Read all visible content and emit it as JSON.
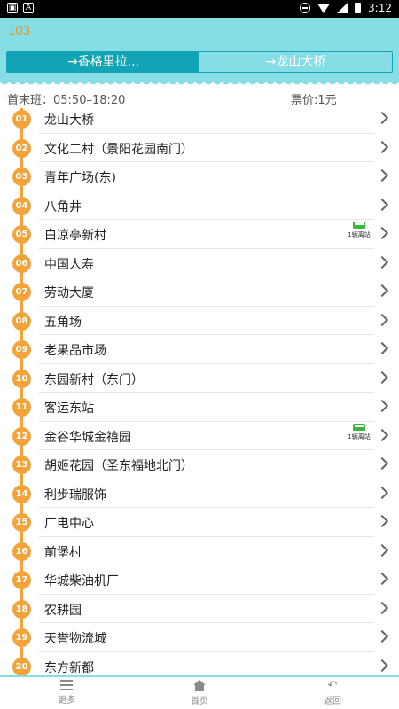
{
  "status_bar": {
    "time": "3:12",
    "left_icons": [
      "notification-icon",
      "a-icon"
    ]
  },
  "app_bar": {
    "title": "103"
  },
  "tabs": [
    {
      "label": "→香格里拉...",
      "active": true
    },
    {
      "label": "→龙山大桥",
      "active": false
    }
  ],
  "info": {
    "hours": "首末班：05:50–18:20",
    "fare": "票价:1元"
  },
  "stops": [
    {
      "num": "01",
      "name": "龙山大桥"
    },
    {
      "num": "02",
      "name": "文化二村（景阳花园南门）"
    },
    {
      "num": "03",
      "name": "青年广场(东)"
    },
    {
      "num": "04",
      "name": "八角井"
    },
    {
      "num": "05",
      "name": "白凉亭新村",
      "bus": "1辆离站"
    },
    {
      "num": "06",
      "name": "中国人寿"
    },
    {
      "num": "07",
      "name": "劳动大厦"
    },
    {
      "num": "08",
      "name": "五角场"
    },
    {
      "num": "09",
      "name": "老果品市场"
    },
    {
      "num": "10",
      "name": "东园新村（东门）"
    },
    {
      "num": "11",
      "name": "客运东站"
    },
    {
      "num": "12",
      "name": "金谷华城金禧园",
      "bus": "1辆离站"
    },
    {
      "num": "13",
      "name": "胡姬花园（圣东福地北门）"
    },
    {
      "num": "14",
      "name": "利步瑞服饰"
    },
    {
      "num": "15",
      "name": "广电中心"
    },
    {
      "num": "16",
      "name": "前堡村"
    },
    {
      "num": "17",
      "name": "华城柴油机厂"
    },
    {
      "num": "18",
      "name": "农耕园"
    },
    {
      "num": "19",
      "name": "天誉物流城"
    },
    {
      "num": "20",
      "name": "东方新都"
    }
  ],
  "bottom_nav": [
    {
      "label": "更多",
      "icon": "menu-icon"
    },
    {
      "label": "首页",
      "icon": "home-icon"
    },
    {
      "label": "返回",
      "icon": "back-icon"
    }
  ],
  "colors": {
    "accent": "#86dde6",
    "tab_active": "#12a3b4",
    "title": "#e09a1e",
    "badge": "#f2a43a",
    "bus": "#3cb53c"
  }
}
